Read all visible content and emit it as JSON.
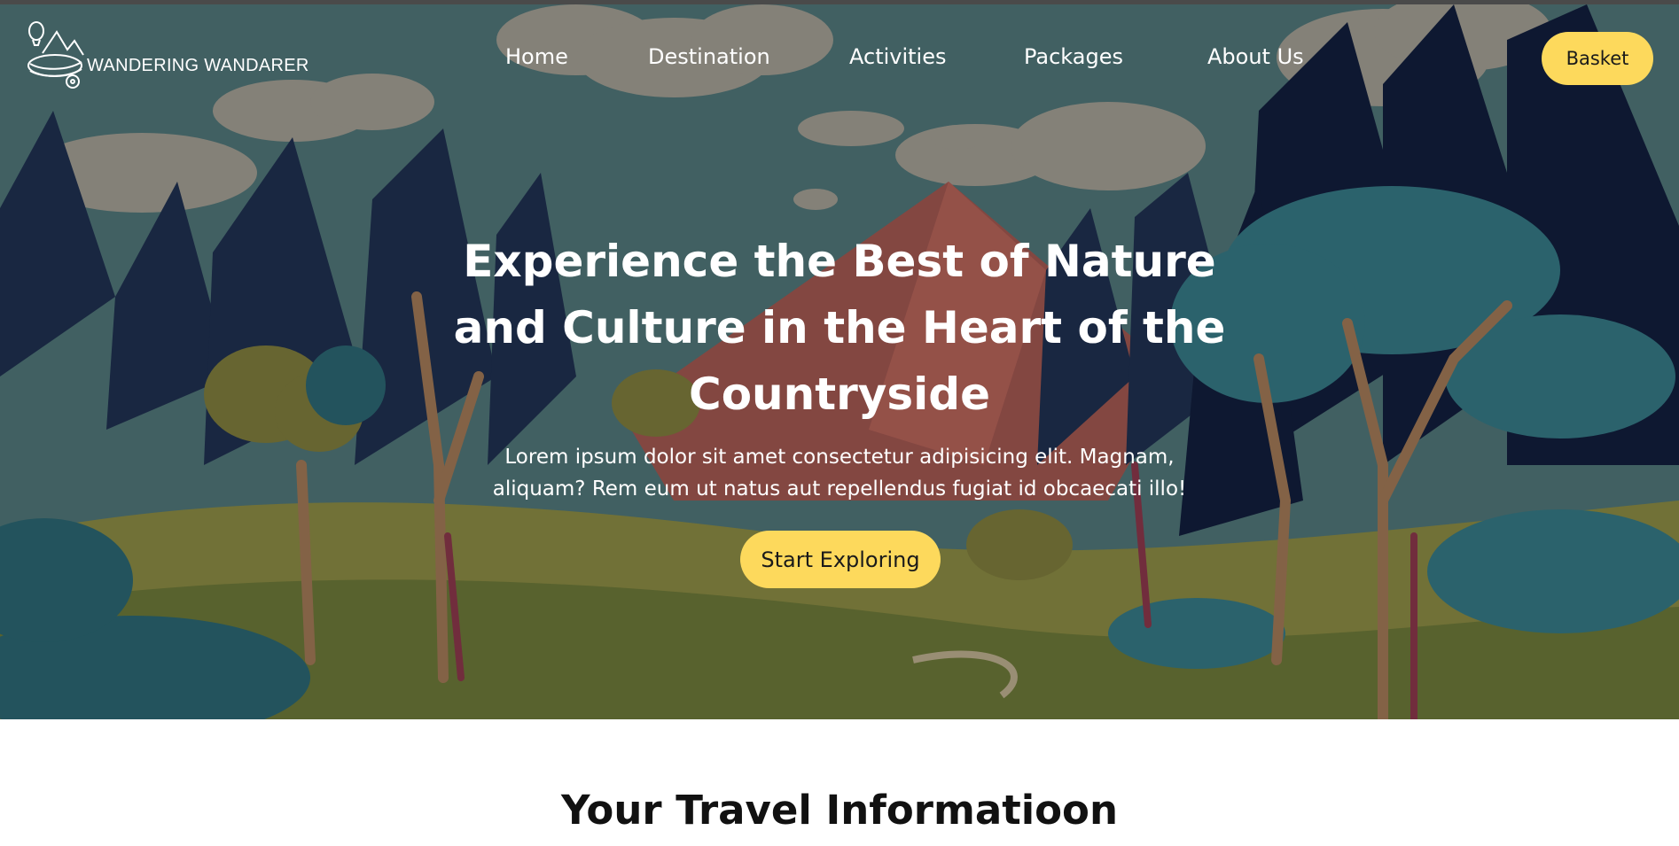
{
  "brand": {
    "name": "WANDERING WANDARER",
    "logo_icon": "travel-globe-balloon-icon"
  },
  "nav": {
    "items": [
      {
        "label": "Home"
      },
      {
        "label": "Destination"
      },
      {
        "label": "Activities"
      },
      {
        "label": "Packages"
      },
      {
        "label": "About Us"
      }
    ],
    "basket_label": "Basket"
  },
  "hero": {
    "headline_lines": [
      "Experience the Best of Nature",
      "and Culture in the Heart of the",
      "Countryside"
    ],
    "subtext_lines": [
      "Lorem ipsum dolor sit amet consectetur adipisicing elit. Magnam,",
      "aliquam? Rem eum ut natus aut repellendus fugiat id obcaecati illo!"
    ],
    "cta_label": "Start Exploring"
  },
  "section": {
    "title": "Your Travel Informatioon"
  },
  "colors": {
    "accent": "#fdd95c",
    "sky": "#466869",
    "forest_dark": "#101a36",
    "meadow": "#7a7a3a"
  }
}
